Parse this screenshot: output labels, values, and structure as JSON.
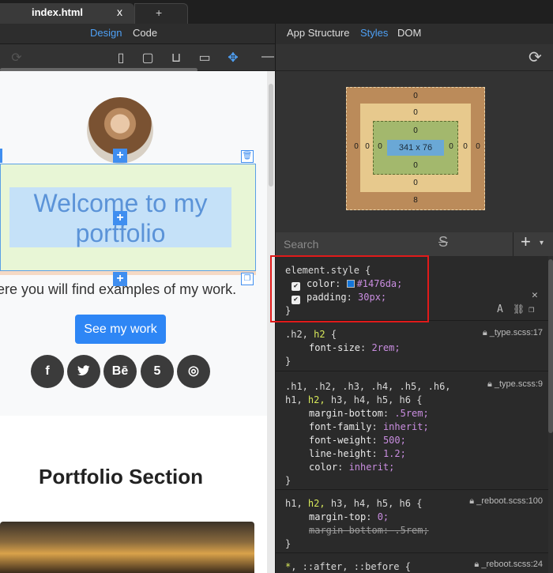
{
  "tabs": {
    "active_file": "index.html",
    "close_glyph": "x",
    "new_glyph": "+"
  },
  "left_pane": {
    "mode_tabs": [
      "Design",
      "Code"
    ],
    "active_mode": "Design"
  },
  "right_pane": {
    "tabs": [
      "App Structure",
      "Styles",
      "DOM"
    ],
    "active_tab": "Styles"
  },
  "canvas": {
    "heading": "Welcome to my portfolio",
    "heading_lines": [
      "Welcome to my",
      "portfolio"
    ],
    "intro_text": "ere you will find examples of my work.",
    "button_label": "See my work",
    "social_icons": [
      "f",
      "t",
      "Bē",
      "5",
      "◎"
    ],
    "section_title": "Portfolio Section"
  },
  "box_model": {
    "margin": {
      "top": "0",
      "right": "0",
      "bottom": "8",
      "left": "0"
    },
    "border": {
      "top": "0",
      "right": "0",
      "bottom": "0",
      "left": "0"
    },
    "padding": {
      "top": "0",
      "right": "0",
      "bottom": "0",
      "left": "0"
    },
    "content": "341 x 76"
  },
  "search": {
    "placeholder": "Search"
  },
  "rules": {
    "element_style": {
      "selector": "element.style {",
      "decls": [
        {
          "prop": "color",
          "value": "#1476da;"
        },
        {
          "prop": "padding",
          "value": "30px;"
        }
      ],
      "close": "}"
    },
    "h2_rule": {
      "selector_a": ".h2,",
      "selector_b": "h2",
      "brace": "{",
      "source": "_type.scss:17",
      "decls": [
        {
          "prop": "font-size",
          "value": "2rem;"
        }
      ],
      "close": "}"
    },
    "headings_rule": {
      "selector_line1": ".h1, .h2, .h3, .h4, .h5, .h6,",
      "selector_line2_a": "h1,",
      "selector_line2_b": "h2,",
      "selector_line2_c": "h3, h4, h5, h6 {",
      "source": "_type.scss:9",
      "decls": [
        {
          "prop": "margin-bottom",
          "value": ".5rem;"
        },
        {
          "prop": "font-family",
          "value": "inherit;"
        },
        {
          "prop": "font-weight",
          "value": "500;"
        },
        {
          "prop": "line-height",
          "value": "1.2;"
        },
        {
          "prop": "color",
          "value": "inherit;"
        }
      ],
      "close": "}"
    },
    "reboot_rule": {
      "selector_a": "h1,",
      "selector_b": "h2,",
      "selector_c": "h3, h4, h5, h6 {",
      "source": "_reboot.scss:100",
      "decls": [
        {
          "prop": "margin-top",
          "value": "0;"
        },
        {
          "prop": "margin-bottom",
          "value": ".5rem;",
          "overridden": true
        }
      ],
      "close": "}"
    },
    "universal_rule": {
      "selector": "*, ::after, ::before {",
      "source": "_reboot.scss:24"
    }
  },
  "colors": {
    "accent": "#3f8ef0",
    "active_tab_text": "#4ea0f5",
    "highlight": "#e01a1a",
    "heading_color": "#1476da"
  }
}
